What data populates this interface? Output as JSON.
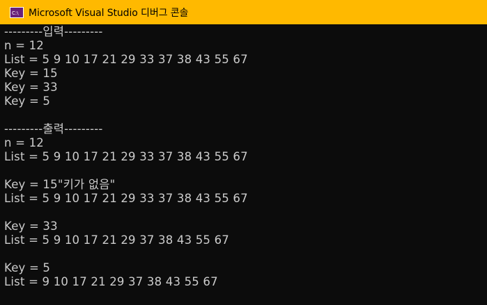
{
  "window": {
    "title": "Microsoft Visual Studio 디버그 콘솔",
    "icon": "visual-studio-console-icon",
    "titlebar_color": "#ffb900",
    "console_bg": "#0c0c0c",
    "console_fg": "#cccccc"
  },
  "console": {
    "lines": [
      "---------입력---------",
      "n = 12",
      "List = 5 9 10 17 21 29 33 37 38 43 55 67",
      "Key = 15",
      "Key = 33",
      "Key = 5",
      "",
      "---------출력---------",
      "n = 12",
      "List = 5 9 10 17 21 29 33 37 38 43 55 67",
      "",
      "Key = 15\"키가 없음\"",
      "List = 5 9 10 17 21 29 33 37 38 43 55 67",
      "",
      "Key = 33",
      "List = 5 9 10 17 21 29 37 38 43 55 67",
      "",
      "Key = 5",
      "List = 9 10 17 21 29 37 38 43 55 67"
    ]
  }
}
